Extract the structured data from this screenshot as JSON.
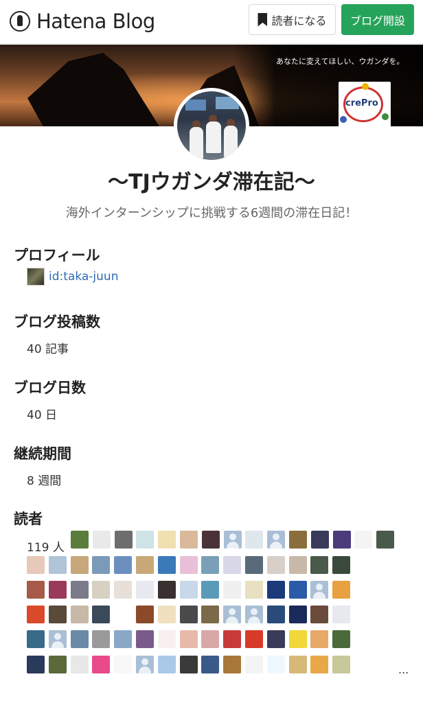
{
  "header": {
    "logo_text": "Hatena Blog",
    "subscribe_label": "読者になる",
    "open_blog_label": "ブログ開設"
  },
  "banner": {
    "tagline": "あなたに変えてほしい、ウガンダを。",
    "logo_text": "crePro"
  },
  "blog": {
    "title": "〜TJウガンダ滞在記〜",
    "description": "海外インターンシップに挑戦する6週間の滞在日記！"
  },
  "sections": {
    "profile": {
      "heading": "プロフィール",
      "user_id": "id:taka-juun"
    },
    "posts": {
      "heading": "ブログ投稿数",
      "value": "40 記事"
    },
    "days": {
      "heading": "ブログ日数",
      "value": "40 日"
    },
    "period": {
      "heading": "継続期間",
      "value": "8 週間"
    },
    "readers": {
      "heading": "読者",
      "count": "119 人",
      "more": "..."
    }
  },
  "colors": {
    "accent_green": "#26a35a",
    "link_blue": "#2f6cb4",
    "default_avatar": "#a9bfd6"
  },
  "reader_avatars": [
    [
      "#5b7d3c",
      "#e9e9e9",
      "#6d6d6d",
      "#cde3e5",
      "#f0e0b0",
      "#d9b99a",
      "#4a3236",
      "#a9bfd6",
      "#dfe6ec",
      "#a9bfd6",
      "#8a6d3b",
      "#3a3a5a",
      "#4b3b7a",
      "#f4f4f4",
      "#4a5a4a"
    ],
    [
      "#e7c9b9",
      "#b0c6d8",
      "#c8a77a",
      "#7a9ab8",
      "#6d8fc0",
      "#c8a878",
      "#3a7ab8",
      "#e8c0d8",
      "#7aa0b8",
      "#d8d8e8",
      "#5a6a7a",
      "#d8d0c8",
      "#c8b8a8",
      "#4a5a4a",
      "#3a4a3a"
    ],
    [
      "#a85a4a",
      "#9a3a5a",
      "#7a7a8a",
      "#d8d0c0",
      "#e8e0d8",
      "#e8e8f0",
      "#3a3030",
      "#c8d8e8",
      "#5a9ab8",
      "#f0f0f0",
      "#e8e0c0",
      "#1a3a7a",
      "#2a5aa8",
      "#a9bfd6",
      "#e8a040"
    ],
    [
      "#d84a2a",
      "#5a4a3a",
      "#c8b8a8",
      "#3a4a5a",
      "#ffffff",
      "#8a4a2a",
      "#f0e0c0",
      "#4a4a4a",
      "#7a6a4a",
      "#a9bfd6",
      "#a9bfd6",
      "#2a4a7a",
      "#1a2a5a",
      "#6a4a3a",
      "#e8e8f0"
    ],
    [
      "#3a6a8a",
      "#a9bfd6",
      "#6a8aa8",
      "#9a9a9a",
      "#8aa8c8",
      "#7a5a8a",
      "#f8f0f0",
      "#e8b8a8",
      "#d8a8a8",
      "#c83a3a",
      "#d83a2a",
      "#3a3a5a",
      "#f0d838",
      "#e8a868",
      "#4a6a3a"
    ],
    [
      "#2a3a5a",
      "#5a6a3a",
      "#e8e8e8",
      "#e84a8a",
      "#f8f8f8",
      "#a9bfd6",
      "#aac8e8",
      "#3a3a3a",
      "#3a5a8a",
      "#a8783a",
      "#f4f4f4",
      "#f0f8ff",
      "#d8b878",
      "#e8a848",
      "#c8c898"
    ]
  ]
}
